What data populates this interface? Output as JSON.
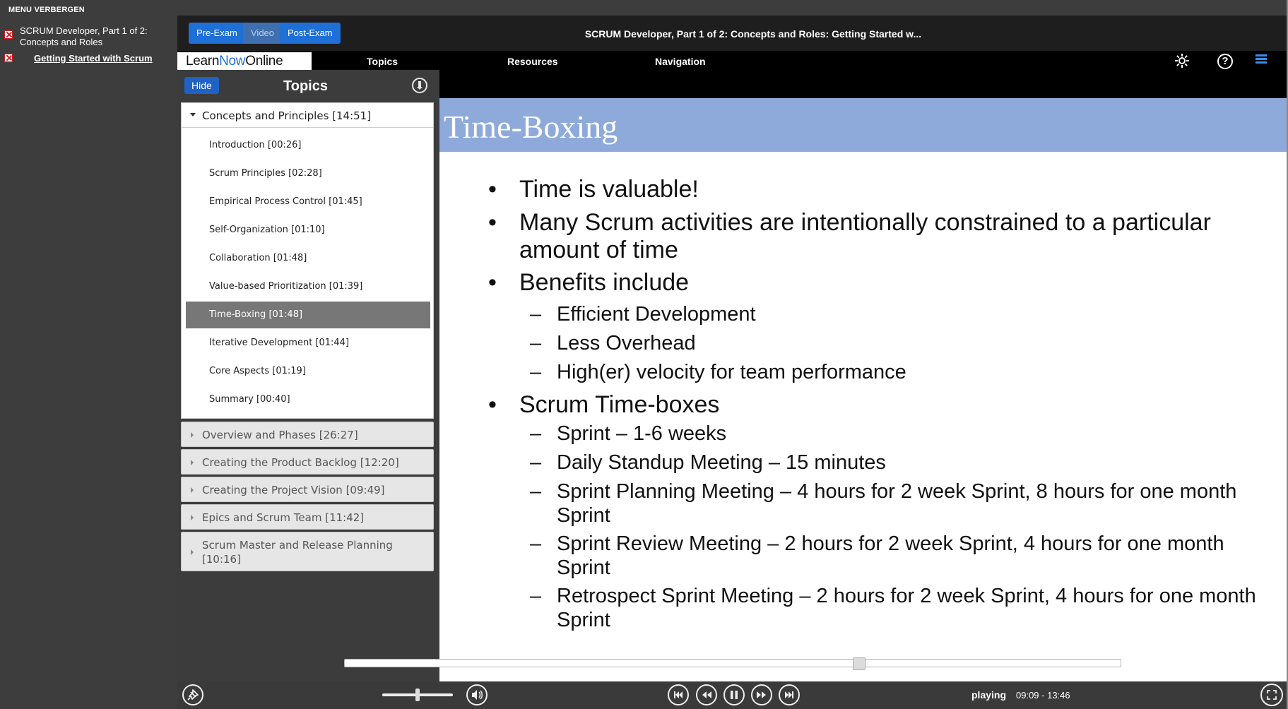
{
  "left_menu": {
    "hide_label": "MENU VERBERGEN",
    "course_title": "SCRUM Developer, Part 1 of 2: Concepts and Roles",
    "course_link": "Getting Started with Scrum"
  },
  "header": {
    "pre_exam": "Pre-Exam",
    "video": "Video",
    "post_exam": "Post-Exam",
    "title": "SCRUM Developer, Part 1 of 2: Concepts and Roles: Getting Started w..."
  },
  "navbar": {
    "logo_learn": "Learn",
    "logo_now": "Now",
    "logo_online": "Online",
    "topics": "Topics",
    "resources": "Resources",
    "navigation": "Navigation",
    "icons": [
      "gear-icon",
      "help-icon",
      "menu-icon"
    ]
  },
  "topics_panel": {
    "hide_button": "Hide",
    "title": "Topics",
    "open_section": {
      "label": "Concepts and Principles [14:51]",
      "items": [
        "Introduction [00:26]",
        "Scrum Principles [02:28]",
        "Empirical Process Control [01:45]",
        "Self-Organization [01:10]",
        "Collaboration [01:48]",
        "Value-based Prioritization [01:39]",
        "Time-Boxing [01:48]",
        "Iterative Development [01:44]",
        "Core Aspects [01:19]",
        "Summary [00:40]"
      ],
      "active_index": 6
    },
    "closed_sections": [
      "Overview and Phases [26:27]",
      "Creating the Product Backlog [12:20]",
      "Creating the Project Vision [09:49]",
      "Epics and Scrum Team [11:42]",
      "Scrum Master and Release Planning [10:16]"
    ]
  },
  "slide": {
    "title": "Time-Boxing",
    "bullets": [
      {
        "text": "Time is valuable!",
        "subs": []
      },
      {
        "text": "Many Scrum activities are intentionally constrained to a particular amount of time",
        "subs": []
      },
      {
        "text": "Benefits include",
        "subs": [
          "Efficient Development",
          "Less Overhead",
          "High(er) velocity for team performance"
        ]
      },
      {
        "text": "Scrum Time-boxes",
        "subs": [
          "Sprint – 1-6 weeks",
          "Daily Standup Meeting – 15 minutes",
          "Sprint Planning Meeting – 4 hours for 2 week Sprint, 8 hours for one month Sprint",
          "Sprint Review Meeting – 2 hours for 2 week Sprint, 4 hours for one month Sprint",
          "Retrospect Sprint Meeting – 2 hours for 2 week Sprint, 4 hours for one month Sprint"
        ]
      }
    ],
    "bullet_marker": "•",
    "sub_marker": "–"
  },
  "player": {
    "progress_fraction": 0.666,
    "volume_fraction": 0.5,
    "status": "playing",
    "time": "09:09 - 13:46"
  },
  "colors": {
    "accent": "#1e70d6",
    "slide_band": "#8eaadb",
    "active_topic": "#777777"
  }
}
